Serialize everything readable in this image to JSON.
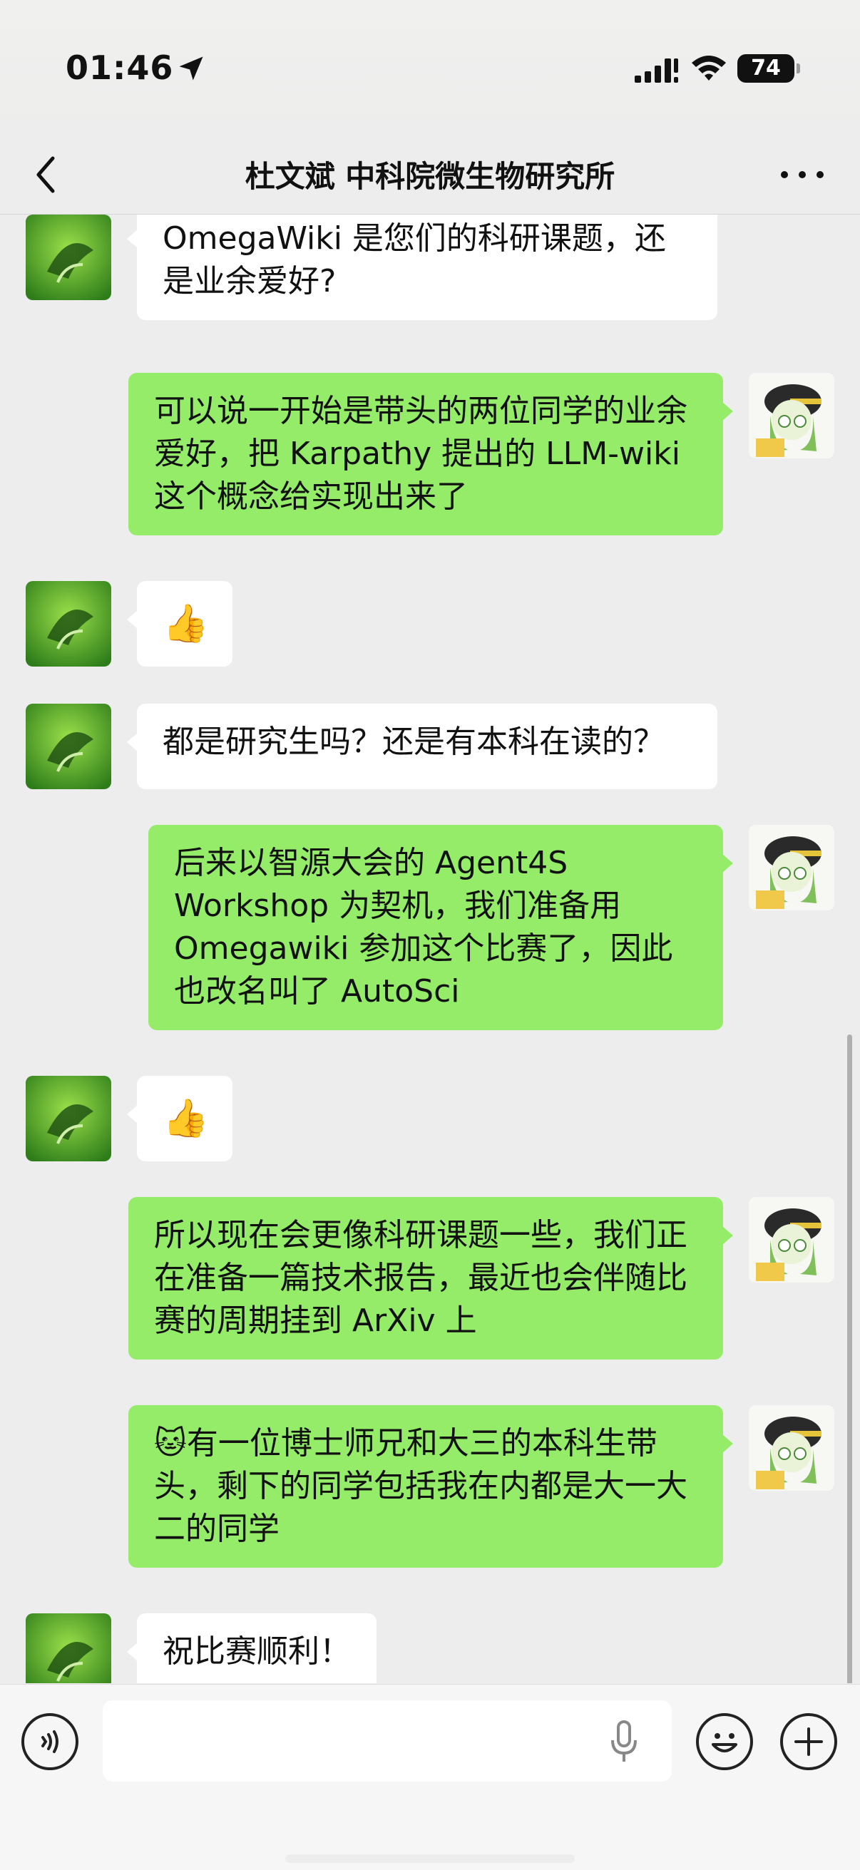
{
  "status": {
    "time": "01:46",
    "battery": "74"
  },
  "nav": {
    "title": "杜文斌 中科院微生物研究所"
  },
  "messages": [
    {
      "from": "them",
      "text": "OmegaWiki 是您们的科研课题，还是业余爱好?"
    },
    {
      "from": "me",
      "text": "可以说一开始是带头的两位同学的业余爱好，把 Karpathy 提出的 LLM-wiki 这个概念给实现出来了"
    },
    {
      "from": "them",
      "text": "👍"
    },
    {
      "from": "them",
      "text": "都是研究生吗？还是有本科在读的？"
    },
    {
      "from": "me",
      "text": "后来以智源大会的 Agent4S Workshop 为契机，我们准备用 Omegawiki 参加这个比赛了，因此也改名叫了 AutoSci"
    },
    {
      "from": "them",
      "text": "👍"
    },
    {
      "from": "me",
      "text": "所以现在会更像科研课题一些，我们正在准备一篇技术报告，最近也会伴随比赛的周期挂到 ArXiv 上"
    },
    {
      "from": "me",
      "text": "🐱有一位博士师兄和大三的本科生带头，剩下的同学包括我在内都是大一大二的同学"
    },
    {
      "from": "them",
      "text": "祝比赛顺利！"
    }
  ],
  "input": {
    "placeholder": ""
  },
  "icons": {
    "back": "chevron-left-icon",
    "more": "more-dots-icon",
    "voice": "voice-icon",
    "mic": "microphone-icon",
    "emoji": "emoji-icon",
    "plus": "plus-icon"
  },
  "colors": {
    "bubble_out": "#95ec69",
    "bubble_in": "#ffffff",
    "background": "#ededed"
  }
}
